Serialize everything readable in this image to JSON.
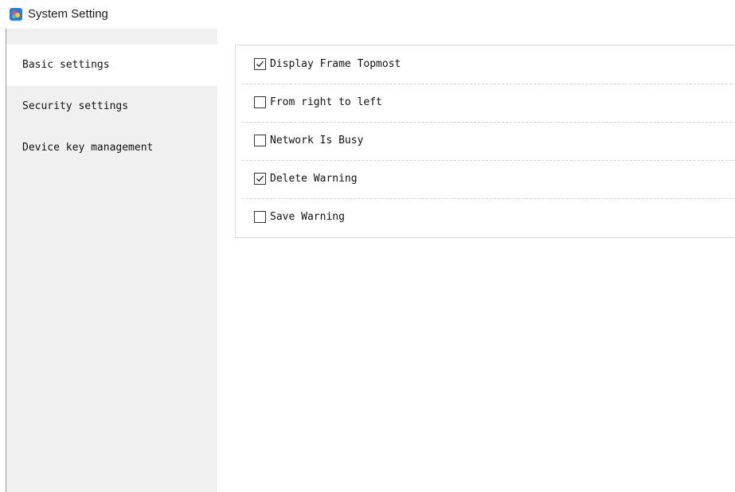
{
  "window": {
    "title": "System Setting",
    "icon": "app-logo-icon"
  },
  "sidebar": {
    "items": [
      {
        "label": "Basic settings",
        "active": true
      },
      {
        "label": "Security settings",
        "active": false
      },
      {
        "label": "Device key management",
        "active": false
      }
    ]
  },
  "options": [
    {
      "label": "Display Frame Topmost",
      "checked": true
    },
    {
      "label": "From right to left",
      "checked": false
    },
    {
      "label": "Network Is Busy",
      "checked": false
    },
    {
      "label": "Delete Warning",
      "checked": true
    },
    {
      "label": "Save Warning",
      "checked": false
    }
  ],
  "colors": {
    "sidebar_bg": "#f0f0f0",
    "active_item_bg": "#ffffff",
    "divider": "#d0d0d0"
  }
}
